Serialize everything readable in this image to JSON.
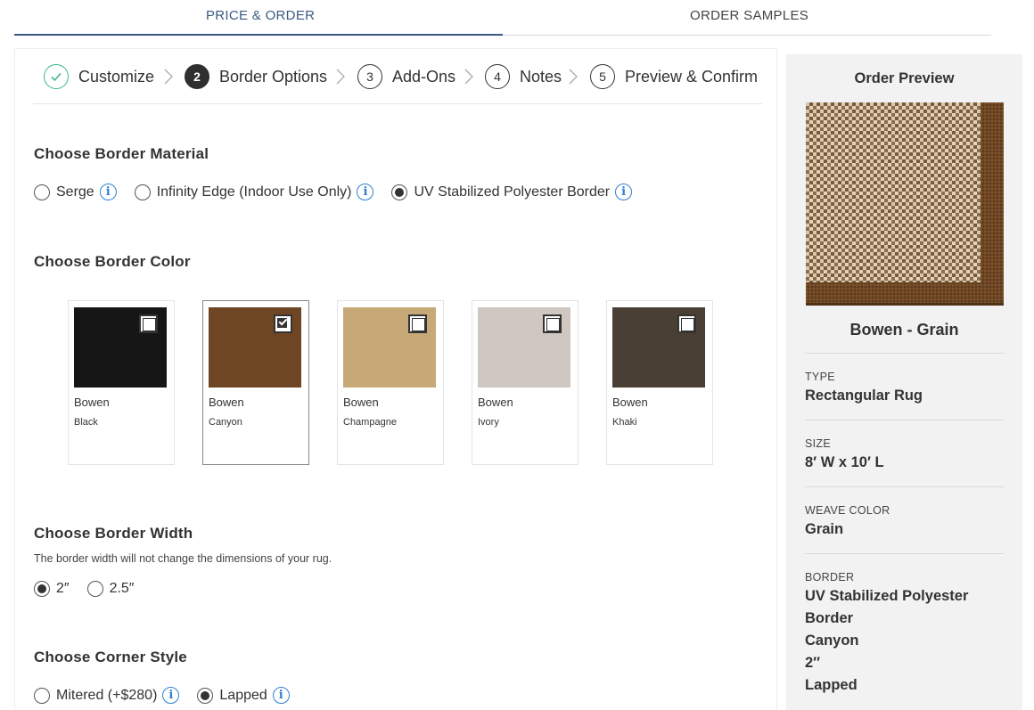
{
  "tabs": [
    {
      "label": "PRICE & ORDER",
      "active": true
    },
    {
      "label": "ORDER SAMPLES",
      "active": false
    }
  ],
  "stepper": {
    "steps": [
      {
        "number": "",
        "label": "Customize",
        "state": "done"
      },
      {
        "number": "2",
        "label": "Border Options",
        "state": "active"
      },
      {
        "number": "3",
        "label": "Add-Ons",
        "state": "pending"
      },
      {
        "number": "4",
        "label": "Notes",
        "state": "pending"
      },
      {
        "number": "5",
        "label": "Preview & Confirm",
        "state": "pending"
      }
    ]
  },
  "border_material": {
    "title": "Choose Border Material",
    "options": [
      {
        "label": "Serge",
        "selected": false
      },
      {
        "label": "Infinity Edge (Indoor Use Only)",
        "selected": false
      },
      {
        "label": "UV Stabilized Polyester Border",
        "selected": true
      }
    ]
  },
  "border_color": {
    "title": "Choose Border Color",
    "swatches": [
      {
        "line": "Bowen",
        "name": "Black",
        "color": "#161616",
        "selected": false
      },
      {
        "line": "Bowen",
        "name": "Canyon",
        "color": "#6e4623",
        "selected": true
      },
      {
        "line": "Bowen",
        "name": "Champagne",
        "color": "#c6a977",
        "selected": false
      },
      {
        "line": "Bowen",
        "name": "Ivory",
        "color": "#cfc8c2",
        "selected": false
      },
      {
        "line": "Bowen",
        "name": "Khaki",
        "color": "#4a3f35",
        "selected": false
      }
    ]
  },
  "border_width": {
    "title": "Choose Border Width",
    "note": "The border width will not change the dimensions of your rug.",
    "options": [
      {
        "label": "2″",
        "selected": true
      },
      {
        "label": "2.5″",
        "selected": false
      }
    ]
  },
  "corner_style": {
    "title": "Choose Corner Style",
    "options": [
      {
        "label": "Mitered (+$280)",
        "selected": false
      },
      {
        "label": "Lapped",
        "selected": true
      }
    ]
  },
  "info_icon": "i",
  "preview": {
    "title": "Order Preview",
    "product_name": "Bowen - Grain",
    "type_label": "TYPE",
    "type_value": "Rectangular Rug",
    "size_label": "SIZE",
    "size_value": "8′ W x 10′ L",
    "weave_label": "WEAVE COLOR",
    "weave_value": "Grain",
    "border_label": "BORDER",
    "border_lines": [
      "UV Stabilized Polyester",
      "Border",
      "Canyon",
      "2″",
      "Lapped"
    ]
  },
  "colors": {
    "accent": "#3b5a82",
    "done_green": "#3fb58c",
    "info_blue": "#2f7fd1"
  }
}
